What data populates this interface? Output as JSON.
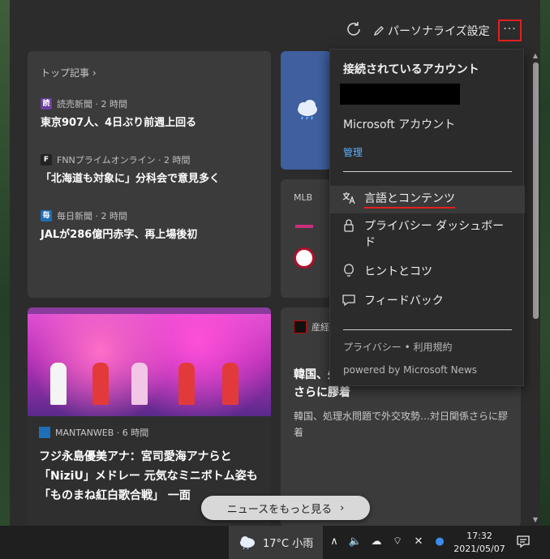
{
  "toolbar": {
    "personalize_label": "パーソナライズ設定",
    "more_label": "···"
  },
  "top_stories": {
    "header": "トップ記事 ›",
    "items": [
      {
        "source": "読売新聞 · 2 時間",
        "logo": "読",
        "logo_color": "#6b3fa0",
        "title": "東京907人、4日ぶり前週上回る"
      },
      {
        "source": "FNNプライムオンライン · 2 時間",
        "logo": "F",
        "logo_color": "#222222",
        "title": "「北海道も対象に」分科会で意見多く"
      },
      {
        "source": "毎日新聞 · 2 時間",
        "logo": "毎",
        "logo_color": "#1e6fb8",
        "title": "JALが286億円赤字、再上場後初"
      }
    ]
  },
  "mlb_card": {
    "label": "MLB"
  },
  "photo_card": {
    "source": "MANTANWEB · 6 時間",
    "title": "フジ永島優美アナ：宮司愛海アナらと「NiziU」メドレー 元気なミニボトム姿も 「ものまね紅白歌合戦」 一面"
  },
  "right_card": {
    "source": "産経",
    "title": "韓国、処理水問題で外交攻勢…対日関係さらに膠着",
    "body": "韓国、処理水問題で外交攻勢…対日関係さらに膠着"
  },
  "menu": {
    "section_title": "接続されているアカウント",
    "ms_account": "Microsoft アカウント",
    "manage": "管理",
    "items": [
      {
        "label": "言語とコンテンツ",
        "icon": "language-icon"
      },
      {
        "label": "プライバシー ダッシュボード",
        "icon": "lock-icon"
      },
      {
        "label": "ヒントとコツ",
        "icon": "lightbulb-icon"
      },
      {
        "label": "フィードバック",
        "icon": "feedback-icon"
      }
    ],
    "privacy_link": "プライバシー • 利用規約",
    "powered_by": "powered by Microsoft News"
  },
  "more_news": {
    "label": "ニュースをもっと見る",
    "chevron": "›"
  },
  "taskbar": {
    "weather": "17°C 小雨",
    "time": "17:32",
    "date": "2021/05/07"
  },
  "colors": {
    "accent_red": "#e3201e",
    "link_blue": "#5ab0ff",
    "weather_card": "#3f5f9f"
  }
}
